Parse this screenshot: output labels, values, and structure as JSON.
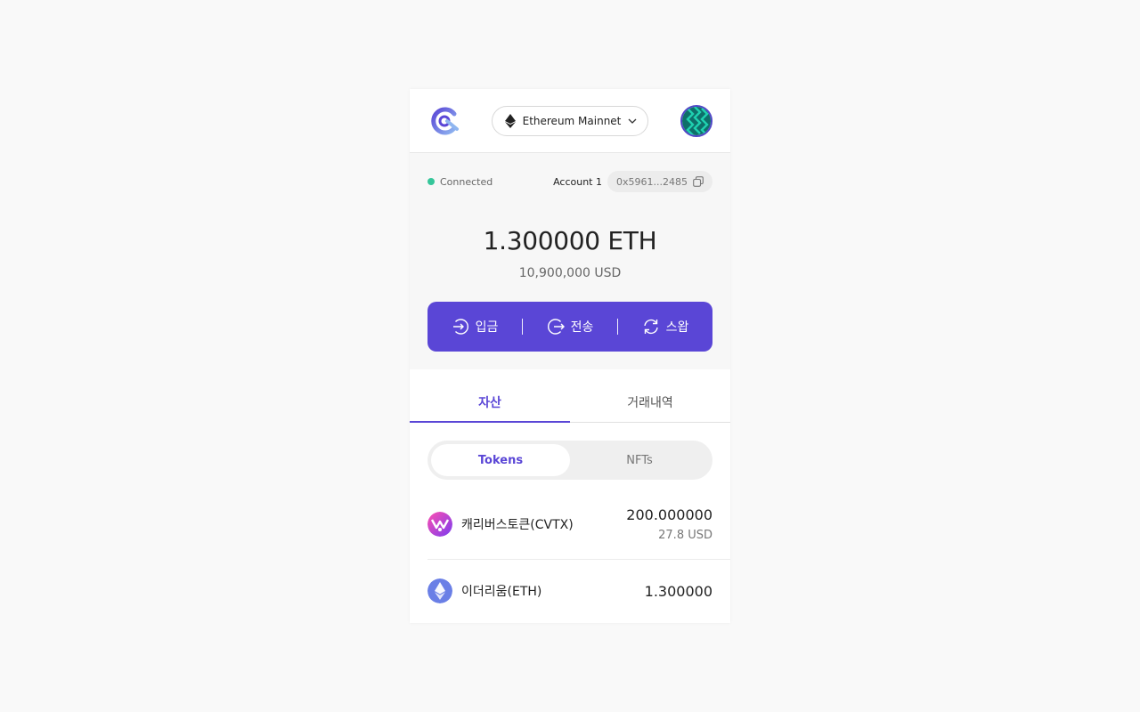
{
  "header": {
    "logo_icon": "curvy-logo-icon",
    "network": {
      "label": "Ethereum Mainnet",
      "icon": "ethereum-icon"
    },
    "avatar_icon": "account-avatar-icon"
  },
  "status": {
    "connection_label": "Connected",
    "connection_color": "#35c69a",
    "account_name": "Account 1",
    "address": "0x5961...2485",
    "copy_icon": "copy-icon"
  },
  "balance": {
    "amount": "1.300000 ETH",
    "usd": "10,900,000 USD"
  },
  "actions": [
    {
      "label": "입금",
      "icon": "deposit-icon"
    },
    {
      "label": "전송",
      "icon": "send-icon"
    },
    {
      "label": "스왑",
      "icon": "swap-icon"
    }
  ],
  "tabs": [
    {
      "label": "자산",
      "active": true
    },
    {
      "label": "거래내역",
      "active": false
    }
  ],
  "segment": [
    {
      "label": "Tokens",
      "active": true
    },
    {
      "label": "NFTs",
      "active": false
    }
  ],
  "tokens": [
    {
      "name": "캐리버스토큰(CVTX)",
      "amount": "200.000000",
      "usd": "27.8 USD",
      "icon": "cvtx-token-icon"
    },
    {
      "name": "이더리움(ETH)",
      "amount": "1.300000",
      "usd": "",
      "icon": "eth-token-icon"
    }
  ],
  "colors": {
    "accent": "#5a46d6",
    "background": "#f9f9f9",
    "summary_bg": "#f7f7f7"
  }
}
